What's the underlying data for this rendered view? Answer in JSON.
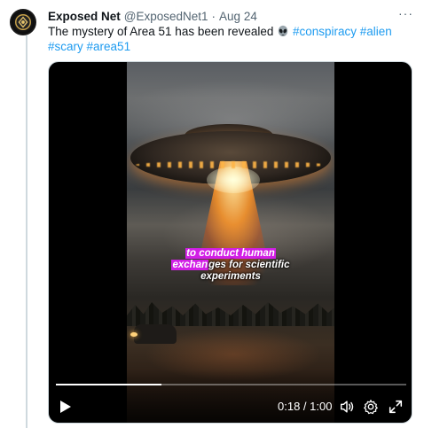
{
  "tweet": {
    "author_name": "Exposed Net",
    "handle": "@ExposedNet1",
    "separator": "·",
    "date": "Aug 24",
    "more_label": "···",
    "text_prefix": "The mystery of Area 51 has been revealed",
    "emoji": "alien-emoji",
    "hashtags": [
      "#conspiracy",
      "#alien",
      "#scary",
      "#area51"
    ]
  },
  "video": {
    "caption": {
      "line1": "to conduct human",
      "line2_highlight": "exchan",
      "line2_rest": "ges for scientific",
      "line3": "experiments"
    },
    "progress_fraction": 0.3,
    "time_display": "0:18 / 1:00",
    "controls": {
      "play_icon": "play-icon",
      "volume_icon": "volume-icon",
      "settings_icon": "gear-icon",
      "fullscreen_icon": "expand-icon"
    }
  },
  "colors": {
    "hashtag": "#1d9bf0",
    "caption_highlight": "#d21ee6",
    "secondary_text": "#536471"
  }
}
